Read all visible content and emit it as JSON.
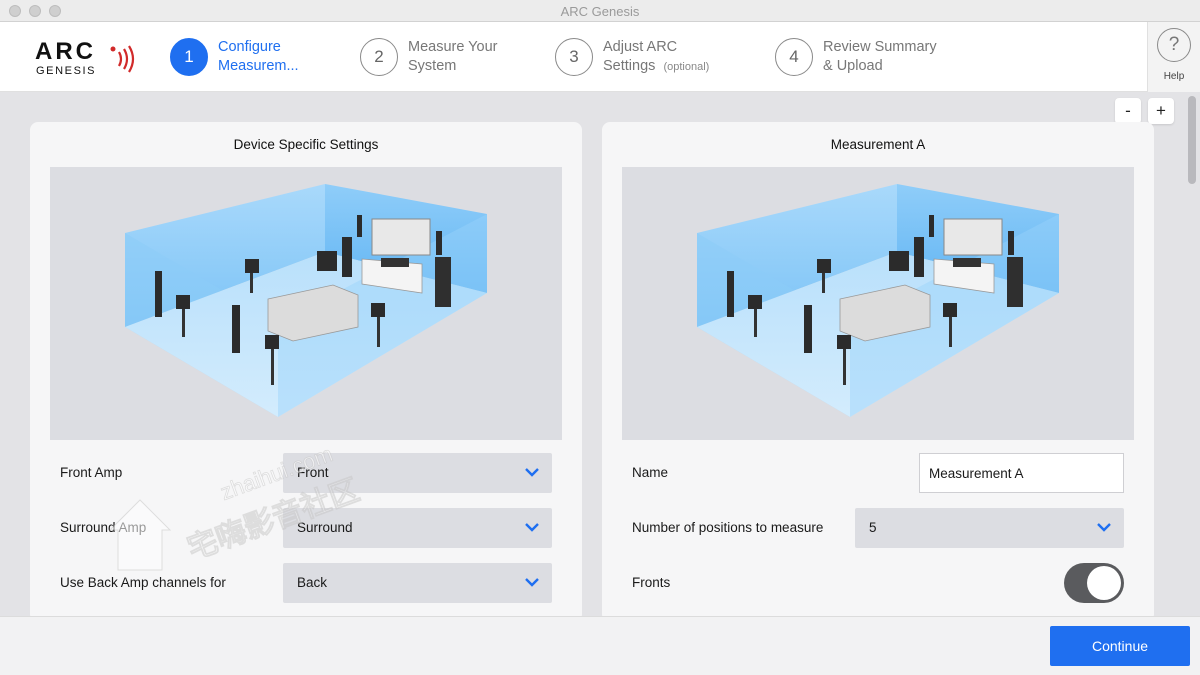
{
  "window": {
    "title": "ARC Genesis"
  },
  "brand": {
    "logo_main": "ARC",
    "logo_sub": "GENESIS"
  },
  "steps": [
    {
      "number": "1",
      "line1": "Configure",
      "line2": "Measurem...",
      "active": true
    },
    {
      "number": "2",
      "line1": "Measure Your",
      "line2": "System",
      "active": false
    },
    {
      "number": "3",
      "line1": "Adjust ARC",
      "line2": "Settings",
      "optional": "(optional)",
      "active": false
    },
    {
      "number": "4",
      "line1": "Review Summary",
      "line2": "& Upload",
      "active": false
    }
  ],
  "help": {
    "icon_glyph": "?",
    "label": "Help"
  },
  "zoom": {
    "minus": "-",
    "plus": "+"
  },
  "left_panel": {
    "title": "Device Specific Settings",
    "rows": [
      {
        "label": "Front Amp",
        "value": "Front"
      },
      {
        "label": "Surround Amp",
        "value": "Surround"
      },
      {
        "label": "Use Back Amp channels for",
        "value": "Back"
      }
    ]
  },
  "right_panel": {
    "title": "Measurement A",
    "name_label": "Name",
    "name_value": "Measurement A",
    "positions_label": "Number of positions to measure",
    "positions_value": "5",
    "fronts_label": "Fronts",
    "fronts_on": true
  },
  "footer": {
    "continue_label": "Continue"
  },
  "watermark": {
    "url": "zhaihui.com",
    "text": "宅嗨影音社区"
  },
  "icons": {
    "dropdown": "chevron-down-icon",
    "help": "question-mark-icon",
    "logo_waves": "sound-waves-icon"
  },
  "colors": {
    "accent": "#1f6ff0",
    "logo_waves": "#d12a2a",
    "toggle_on": "#5a5b5e",
    "room_blue": "#6ab8f5"
  }
}
